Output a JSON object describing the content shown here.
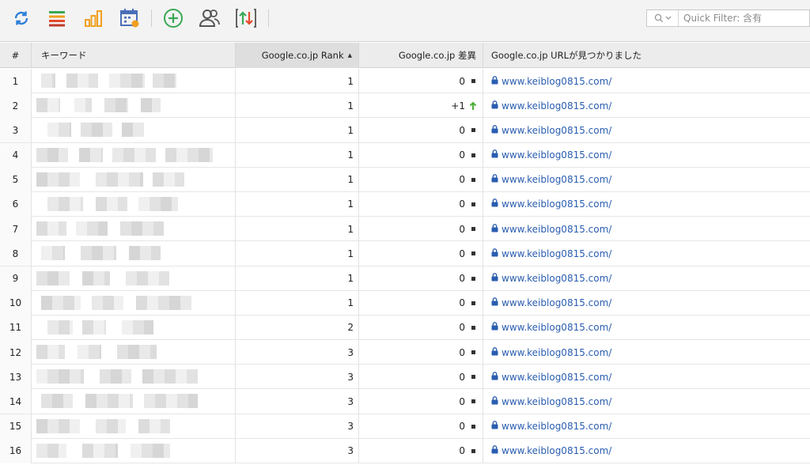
{
  "toolbar": {
    "icons": [
      {
        "name": "refresh-icon",
        "color": "#2d7fd8"
      },
      {
        "name": "list-icon",
        "color": "#3aa853"
      },
      {
        "name": "bar-chart-icon",
        "color": "#f0a020"
      },
      {
        "name": "calendar-icon",
        "color": "#4a6fb8"
      },
      {
        "name": "add-circle-icon",
        "color": "#3aa853"
      },
      {
        "name": "users-icon",
        "color": "#555555"
      },
      {
        "name": "sort-updown-icon",
        "color": "#3aa853"
      }
    ],
    "filter_placeholder": "Quick Filter: 含有"
  },
  "table": {
    "columns": {
      "num": "#",
      "keyword": "キーワード",
      "rank": "Google.co.jp Rank",
      "diff": "Google.co.jp 差異",
      "url": "Google.co.jp URLが見つかりました"
    },
    "rows": [
      {
        "num": "1",
        "rank": "1",
        "diff": "0",
        "trend": "flat",
        "url": "www.keiblog0815.com/"
      },
      {
        "num": "2",
        "rank": "1",
        "diff": "+1",
        "trend": "up",
        "url": "www.keiblog0815.com/"
      },
      {
        "num": "3",
        "rank": "1",
        "diff": "0",
        "trend": "flat",
        "url": "www.keiblog0815.com/"
      },
      {
        "num": "4",
        "rank": "1",
        "diff": "0",
        "trend": "flat",
        "url": "www.keiblog0815.com/"
      },
      {
        "num": "5",
        "rank": "1",
        "diff": "0",
        "trend": "flat",
        "url": "www.keiblog0815.com/"
      },
      {
        "num": "6",
        "rank": "1",
        "diff": "0",
        "trend": "flat",
        "url": "www.keiblog0815.com/"
      },
      {
        "num": "7",
        "rank": "1",
        "diff": "0",
        "trend": "flat",
        "url": "www.keiblog0815.com/"
      },
      {
        "num": "8",
        "rank": "1",
        "diff": "0",
        "trend": "flat",
        "url": "www.keiblog0815.com/"
      },
      {
        "num": "9",
        "rank": "1",
        "diff": "0",
        "trend": "flat",
        "url": "www.keiblog0815.com/"
      },
      {
        "num": "10",
        "rank": "1",
        "diff": "0",
        "trend": "flat",
        "url": "www.keiblog0815.com/"
      },
      {
        "num": "11",
        "rank": "2",
        "diff": "0",
        "trend": "flat",
        "url": "www.keiblog0815.com/"
      },
      {
        "num": "12",
        "rank": "3",
        "diff": "0",
        "trend": "flat",
        "url": "www.keiblog0815.com/"
      },
      {
        "num": "13",
        "rank": "3",
        "diff": "0",
        "trend": "flat",
        "url": "www.keiblog0815.com/"
      },
      {
        "num": "14",
        "rank": "3",
        "diff": "0",
        "trend": "flat",
        "url": "www.keiblog0815.com/"
      },
      {
        "num": "15",
        "rank": "3",
        "diff": "0",
        "trend": "flat",
        "url": "www.keiblog0815.com/"
      },
      {
        "num": "16",
        "rank": "3",
        "diff": "0",
        "trend": "flat",
        "url": "www.keiblog0815.com/"
      }
    ]
  },
  "colors": {
    "link": "#2a5db0",
    "trend_up": "#4caf3a",
    "header_bg": "#ececec"
  }
}
